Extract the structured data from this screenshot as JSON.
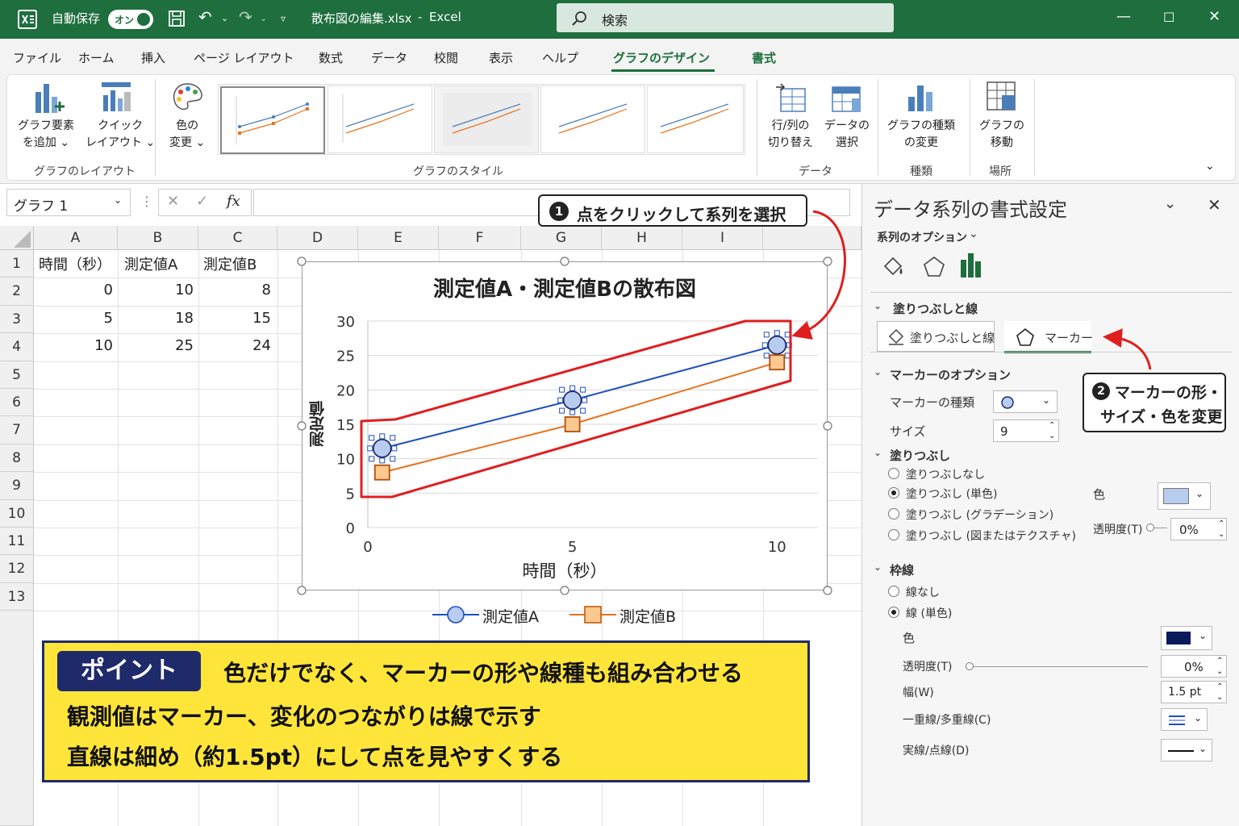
{
  "titlebar": {
    "autosave_label": "自動保存",
    "autosave_state": "オン",
    "filename": "散布図の編集.xlsx",
    "separator": "-",
    "app": "Excel",
    "search_placeholder": "検索"
  },
  "tabs": [
    "ファイル",
    "ホーム",
    "挿入",
    "ページ レイアウト",
    "数式",
    "データ",
    "校閲",
    "表示",
    "ヘルプ",
    "グラフのデザイン",
    "書式"
  ],
  "active_tab": "グラフのデザイン",
  "ribbon": {
    "add_element": "グラフ要素\nを追加 ⌄",
    "quick_layout": "クイック\nレイアウト ⌄",
    "change_color": "色の\n変更 ⌄",
    "switch_row_col": "行/列の\n切り替え",
    "select_data": "データの\n選択",
    "change_type": "グラフの種類\nの変更",
    "move_chart": "グラフの\n移動",
    "groups": {
      "layout": "グラフのレイアウト",
      "styles": "グラフのスタイル",
      "data": "データ",
      "type": "種類",
      "location": "場所"
    }
  },
  "formula_bar": {
    "name_box": "グラフ 1",
    "fx": "fx"
  },
  "columns": [
    "A",
    "B",
    "C",
    "D",
    "E",
    "F",
    "G",
    "H",
    "I"
  ],
  "rows": [
    "1",
    "2",
    "3",
    "4",
    "5",
    "6",
    "7",
    "8",
    "9",
    "10",
    "11",
    "12",
    "13"
  ],
  "table": {
    "headers": [
      "時間（秒）",
      "測定値A",
      "測定値B"
    ],
    "data": [
      [
        "0",
        "10",
        "8"
      ],
      [
        "5",
        "18",
        "15"
      ],
      [
        "10",
        "25",
        "24"
      ]
    ]
  },
  "chart_data": {
    "type": "line",
    "title": "測定値A・測定値Bの散布図",
    "xlabel": "時間（秒）",
    "ylabel": "測定値",
    "x": [
      0,
      5,
      10
    ],
    "xticks": [
      "0",
      "5",
      "10"
    ],
    "yticks": [
      "0",
      "5",
      "10",
      "15",
      "20",
      "25",
      "30"
    ],
    "xlim": [
      0,
      11
    ],
    "ylim": [
      0,
      30
    ],
    "series": [
      {
        "name": "測定値A",
        "values": [
          11.5,
          18.5,
          26.5
        ],
        "color": "#1f4fbf",
        "marker": "circle",
        "marker_fill": "#b8ccf0"
      },
      {
        "name": "測定値B",
        "values": [
          8,
          15,
          24
        ],
        "color": "#e8731e",
        "marker": "square",
        "marker_fill": "#fbc98f"
      }
    ],
    "legend": "bottom",
    "grid": "horizontal"
  },
  "callouts": {
    "step1_num": "1",
    "step1": "点をクリックして系列を選択",
    "step2_num": "2",
    "step2_line1": "マーカーの形・",
    "step2_line2": "サイズ・色を変更"
  },
  "point_box": {
    "badge": "ポイント",
    "line1": "色だけでなく、マーカーの形や線種も組み合わせる",
    "line2": "観測値はマーカー、変化のつながりは線で示す",
    "line3": "直線は細め（約1.5pt）にして点を見やすくする"
  },
  "pane": {
    "title": "データ系列の書式設定",
    "series_options": "系列のオプション",
    "section_fill_line": "塗りつぶしと線",
    "tab_fill_line": "塗りつぶしと線",
    "tab_marker": "マーカー",
    "marker_options": "マーカーのオプション",
    "marker_type_label": "マーカーの種類",
    "size_label": "サイズ",
    "size_value": "9",
    "fill_heading": "塗りつぶし",
    "fill_options": [
      "塗りつぶしなし",
      "塗りつぶし (単色)",
      "塗りつぶし (グラデーション)",
      "塗りつぶし (図またはテクスチャ)"
    ],
    "fill_selected": 1,
    "fill_color_label": "色",
    "fill_color": "#b8ccf0",
    "fill_transparency_label": "透明度(T)",
    "fill_transparency": "0%",
    "border_heading": "枠線",
    "border_options": [
      "線なし",
      "線 (単色)"
    ],
    "border_selected": 1,
    "border_color_label": "色",
    "border_color": "#0b1a5c",
    "border_transparency_label": "透明度(T)",
    "border_transparency": "0%",
    "width_label": "幅(W)",
    "width_value": "1.5 pt",
    "compound_label": "一重線/多重線(C)",
    "dash_label": "実線/点線(D)"
  }
}
